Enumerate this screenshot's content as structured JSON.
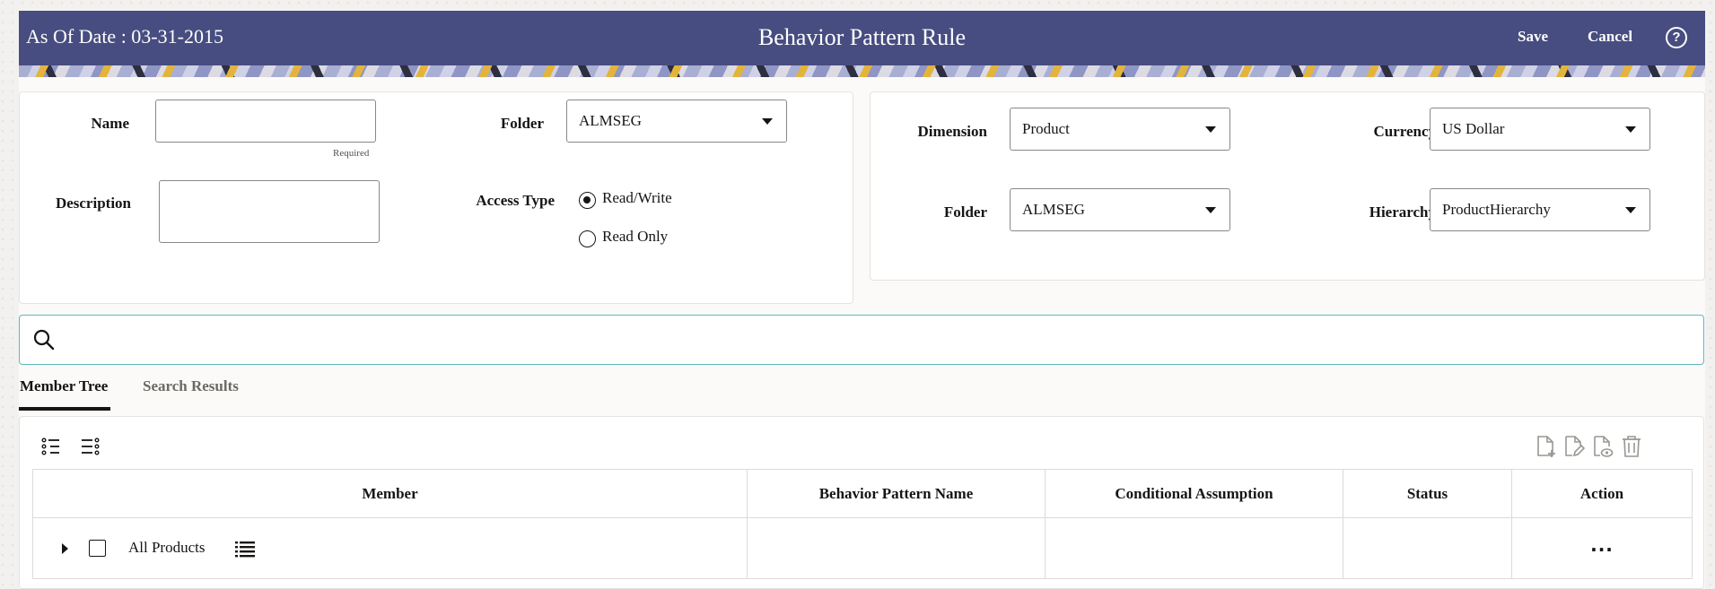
{
  "header": {
    "as_of": "As Of Date : 03-31-2015",
    "title": "Behavior Pattern Rule",
    "save": "Save",
    "cancel": "Cancel",
    "help": "?",
    "color": "#474d80"
  },
  "form_left": {
    "name_label": "Name",
    "name_value": "",
    "required_hint": "Required",
    "description_label": "Description",
    "description_value": "",
    "folder_label": "Folder",
    "folder_value": "ALMSEG",
    "access_type_label": "Access Type",
    "access_options": [
      {
        "label": "Read/Write",
        "selected": true
      },
      {
        "label": "Read Only",
        "selected": false
      }
    ]
  },
  "form_right": {
    "dimension_label": "Dimension",
    "dimension_value": "Product",
    "currency_label": "Currency",
    "currency_value": "US Dollar",
    "folder_label": "Folder",
    "folder_value": "ALMSEG",
    "hierarchy_label": "Hierarchy",
    "hierarchy_value": "ProductHierarchy"
  },
  "search": {
    "placeholder": "",
    "icon": "search-icon"
  },
  "tabs": [
    {
      "label": "Member Tree",
      "active": true
    },
    {
      "label": "Search Results",
      "active": false
    }
  ],
  "toolbar": {
    "left_icons": [
      "expand-all-icon",
      "collapse-all-icon"
    ],
    "right_icons": [
      "add-icon",
      "edit-icon",
      "view-icon",
      "delete-icon"
    ]
  },
  "table": {
    "columns": [
      "Member",
      "Behavior Pattern Name",
      "Conditional Assumption",
      "Status",
      "Action"
    ],
    "rows": [
      {
        "member": "All Products",
        "behavior_pattern_name": "",
        "conditional_assumption": "",
        "status": "",
        "action": "..."
      }
    ]
  }
}
